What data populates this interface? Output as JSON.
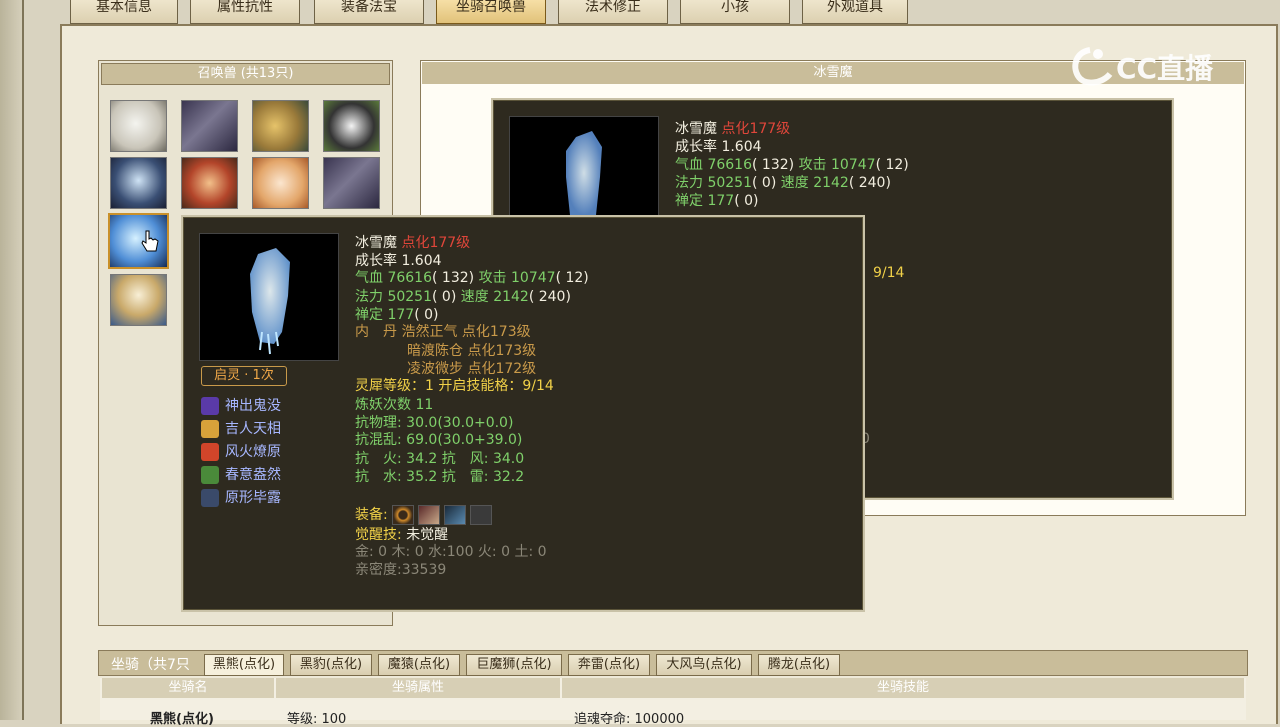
{
  "top_tabs": [
    "基本信息",
    "属性抗性",
    "装备法宝",
    "坐骑召唤兽",
    "法术修正",
    "小孩",
    "外观道具"
  ],
  "summon": {
    "header": "召唤兽 (共13只)",
    "thumbs": [
      "polar-bear",
      "gray-wolf",
      "golden-dragon",
      "panda",
      "ice-maiden",
      "opera-girl",
      "fire-lion",
      "gray-wolf-2",
      "ice-demon",
      "white-haired-hero"
    ]
  },
  "detail": {
    "header": "冰雪魔",
    "name": "冰雪魔",
    "level": "点化177级",
    "growth": "成长率 1.604",
    "hp_label": "气血",
    "hp": "76616",
    "hp_extra": "( 132)",
    "atk_label": "攻击",
    "atk": "10747",
    "atk_extra": "( 12)",
    "mp_label": "法力",
    "mp": "50251",
    "mp_extra": "( 0)",
    "spd_label": "速度",
    "spd": "2142",
    "spd_extra": "( 240)",
    "chan_label": "禅定",
    "chan": "177",
    "chan_extra": "( 0)",
    "partial_frac": "9/14",
    "partial_zero": "0"
  },
  "tooltip": {
    "name": "冰雪魔",
    "level": "点化177级",
    "growth": "成长率 1.604",
    "hp_label": "气血",
    "hp": "76616",
    "hp_extra": "( 132)",
    "atk_label": "攻击",
    "atk": "10747",
    "atk_extra": "( 12)",
    "mp_label": "法力",
    "mp": "50251",
    "mp_extra": "( 0)",
    "spd_label": "速度",
    "spd": "2142",
    "spd_extra": "( 240)",
    "chan_label": "禅定",
    "chan": "177",
    "chan_extra": "( 0)",
    "neidan_label": "内　丹",
    "neidan": [
      "浩然正气 点化173级",
      "暗渡陈仓 点化173级",
      "凌波微步 点化172级"
    ],
    "lingxi": "灵犀等级：1 开启技能格：9/14",
    "lianyao": "炼妖次数 11",
    "kang_wuli": "抗物理: 30.0(30.0+0.0)",
    "kang_hunluan": "抗混乱: 69.0(30.0+39.0)",
    "kang_row1": "抗　火: 34.2 抗　风: 34.0",
    "kang_row2": "抗　水: 35.2 抗　雷: 32.2",
    "equip_label": "装备:",
    "awaken_label": "觉醒技:",
    "awaken_value": "未觉醒",
    "elements": "金: 0 木: 0 水:100 火: 0 土: 0",
    "intimacy": "亲密度:33539",
    "qiling": "启灵 · 1次",
    "skills": [
      "神出鬼没",
      "吉人天相",
      "风火燎原",
      "春意盎然",
      "原形毕露"
    ]
  },
  "mount": {
    "title": "坐骑（共7只",
    "tabs": [
      "黑熊(点化)",
      "黑豹(点化)",
      "魔猿(点化)",
      "巨魔狮(点化)",
      "奔雷(点化)",
      "大风鸟(点化)",
      "腾龙(点化)"
    ],
    "columns": [
      "坐骑名",
      "坐骑属性",
      "坐骑技能"
    ],
    "row_name": "黑熊(点化)",
    "row_attr": "等级: 100",
    "row_skill": "追魂夺命: 100000"
  },
  "watermark": "CC直播",
  "colors": {
    "green": "#7fd06a",
    "red": "#e0463a",
    "yellow": "#f0d048",
    "tooltip_bg": "#2e2a1f"
  }
}
